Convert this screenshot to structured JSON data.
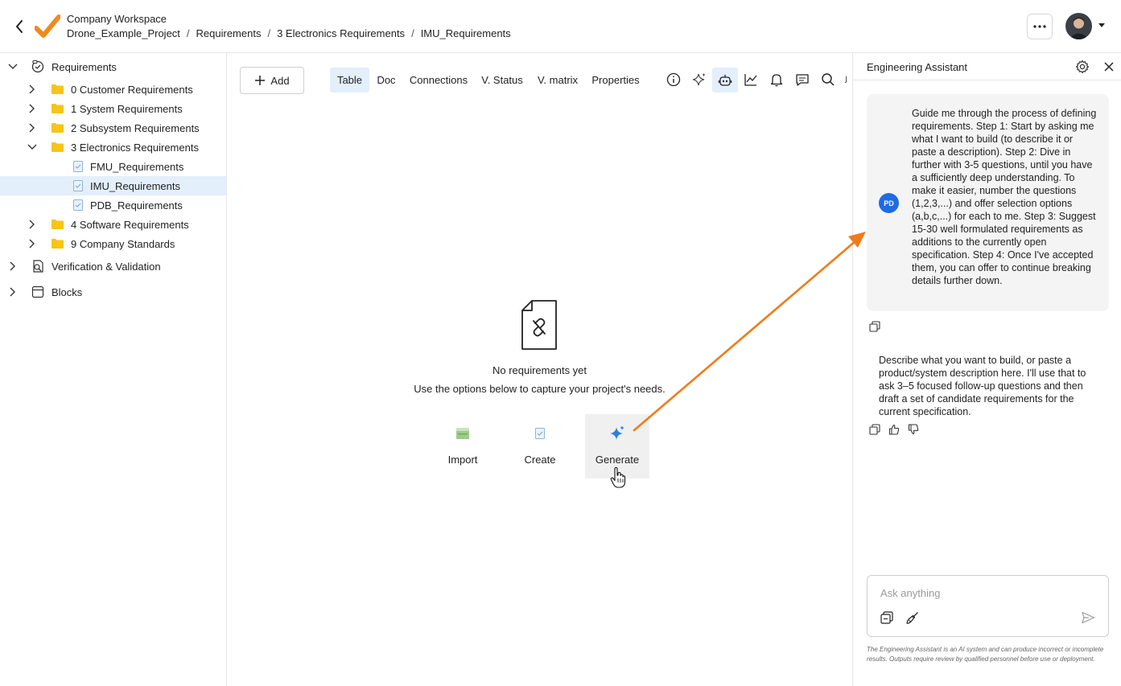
{
  "header": {
    "workspace": "Company Workspace",
    "breadcrumbs": [
      "Drone_Example_Project",
      "Requirements",
      "3 Electronics Requirements",
      "IMU_Requirements"
    ],
    "separator": "/"
  },
  "sidebar": {
    "root": "Requirements",
    "items": [
      {
        "label": "0 Customer Requirements"
      },
      {
        "label": "1 System Requirements"
      },
      {
        "label": "2 Subsystem Requirements"
      },
      {
        "label": "3 Electronics Requirements"
      },
      {
        "label": "FMU_Requirements"
      },
      {
        "label": "IMU_Requirements"
      },
      {
        "label": "PDB_Requirements"
      },
      {
        "label": "4 Software Requirements"
      },
      {
        "label": "9 Company Standards"
      }
    ],
    "sections": [
      "Verification & Validation",
      "Blocks"
    ]
  },
  "toolbar": {
    "add_label": "Add",
    "tabs": [
      "Table",
      "Doc",
      "Connections",
      "V. Status",
      "V. matrix",
      "Properties"
    ],
    "active_tab": "Table",
    "icons": [
      "info-icon",
      "sparkle-icon",
      "robot-icon",
      "chart-icon",
      "bell-icon",
      "comment-icon",
      "search-icon"
    ]
  },
  "empty_state": {
    "title": "No requirements yet",
    "subtitle": "Use the options below to capture your project's needs.",
    "actions": [
      {
        "label": "Import",
        "icon": "import-icon"
      },
      {
        "label": "Create",
        "icon": "create-icon"
      },
      {
        "label": "Generate",
        "icon": "sparkle-icon"
      }
    ]
  },
  "assistant": {
    "title": "Engineering Assistant",
    "user_initials": "PD",
    "user_message": "Guide me through the process of defining requirements. Step 1: Start by asking me what I want to build (to describe it or paste a description). Step 2: Dive in further with 3-5 questions, until you have a sufficiently deep understanding. To make it easier, number the questions (1,2,3,...) and offer selection options (a,b,c,...) for each to me. Step 3: Suggest 15-30 well formulated requirements as additions to the currently open specification. Step 4: Once I've accepted them, you can offer to continue breaking details further down.",
    "bot_message": "Describe what you want to build, or paste a product/system description here. I'll use that to ask 3–5 focused follow-up questions and then draft a set of candidate requirements for the current specification.",
    "input_placeholder": "Ask anything",
    "disclaimer": "The Engineering Assistant is an AI system and can produce incorrect or incomplete results. Outputs require review by qualified personnel before use or deployment."
  },
  "colors": {
    "accent": "#1e6ce0",
    "selection": "#e3effb",
    "arrow": "#f07b1c",
    "folder": "#f5c518"
  }
}
